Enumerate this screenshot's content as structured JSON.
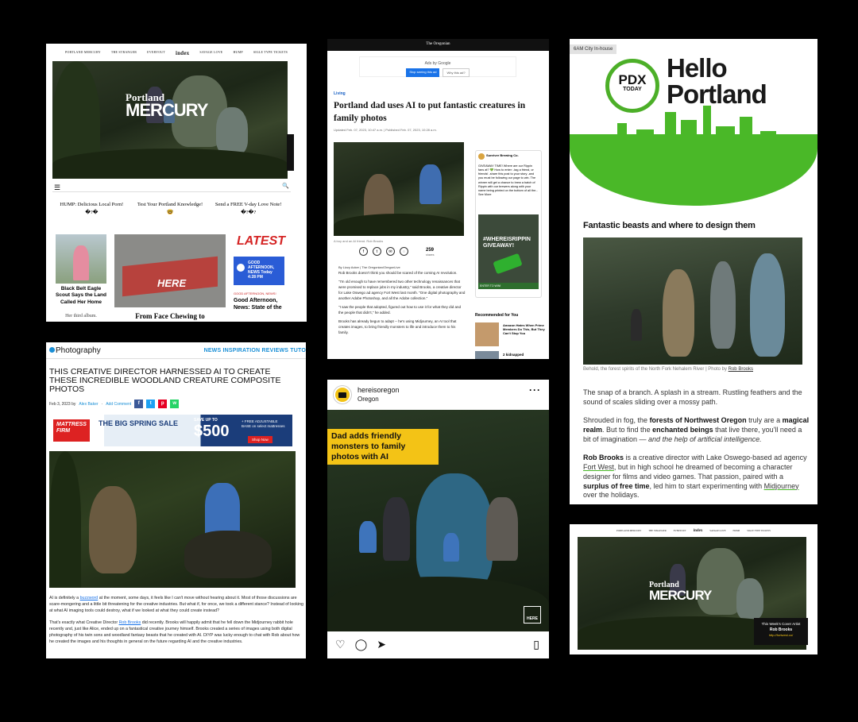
{
  "panel1": {
    "nav": [
      "PORTLAND MERCURY",
      "THE STRANGER",
      "EVERYOUT",
      "index",
      "SAVAGE LOVE",
      "HUMP",
      "SIGLE TYPE TICKETS"
    ],
    "logo_top": "Portland",
    "logo_main": "MERCURY",
    "teasers": [
      "HUMP: Delicious Local Porn! �?�",
      "Test Your Portland Knowledge! 🤓",
      "Send a FREE V-day Love Note! �?�?"
    ],
    "story1_title": "Black Belt Eagle Scout Says the Land Called Her Home",
    "story1_sub": "Her third album.",
    "story2_sign": "HERE",
    "story2_title": "From Face Chewing to",
    "latest": "LATEST",
    "news_card": "GOOD AFTERNOON, NEWS Today 4:28 PM",
    "news_kicker": "GOOD AFTERNOON, NEWS!",
    "news_title": "Good Afternoon, News: State of the"
  },
  "panel2": {
    "topbar": "The Oregonian",
    "ad_label": "Ads by Google",
    "ad_btn1": "Stop seeing this ad",
    "ad_btn2": "Why this ad?",
    "section": "Living",
    "title": "Portland dad uses AI to put fantastic creatures in family photos",
    "meta": "Updated Feb. 07, 2023, 10:47 a.m. | Published Feb. 07, 2023, 10:28 a.m.",
    "caption": "A boy and an AI friend. Rob Brooks",
    "share_count": "259",
    "share_label": "shares",
    "byline": "By Lizzy Acker | The Oregonian/OregonLive",
    "paragraphs": [
      "Rob Brooks doesn't think you should be scared of the coming AI revolution.",
      "\"I'm old enough to have remembered two other technology renaissances that were promised to replace jobs in my industry,\" said Brooks, a creative director for Lake Oswego ad agency Fort West last month. \"One digital photography and another Adobe Photoshop, and all the Adobe collection.\"",
      "\"I saw the people that adopted, figured out how to use it for what they did and the people that didn't,\" he added.",
      "Brooks has already begun to adapt -- he's using Midjourney, an AI tool that creates images, to bring friendly monsters to life and introduce them to his family."
    ],
    "fb_page": "Sunriver Brewing Co.",
    "fb_text": "GIVEAWAY TIME! Where are our Rippin fans at? 💚 How to enter: -tag a friend, or friends! -share this post to your story -and you must be following our page to win. The winner will get a chance to brew a batch of Rippin with our brewers along with your name being printed on the bottom of all the... See More",
    "fb_ad": "#WHEREISRIPPIN GIVEAWAY!",
    "fb_cta": "ENTER TO WIN!",
    "rec_header": "Recommended for You",
    "rec1": "Amazon Hates When Prime Members Do This, But They Can't Stop You",
    "rec2": "2 kidnapped"
  },
  "panel3": {
    "tag": "6AM City In-house",
    "logo_pdx": "PDX",
    "logo_today": "TODAY",
    "hello": "Hello",
    "portland": "Portland",
    "heading": "Fantastic beasts and where to design them",
    "caption": "Behold, the forest spirits of the North Fork Nehalem River | Photo by ",
    "caption_link": "Rob Brooks",
    "p1": "The snap of a branch. A splash in a stream. Rustling feathers and the sound of scales sliding over a mossy path.",
    "p2a": "Shrouded in fog, the ",
    "p2b": "forests of Northwest Oregon",
    "p2c": " truly are a ",
    "p2d": "magical realm",
    "p2e": ". But to find the ",
    "p2f": "enchanted beings",
    "p2g": " that live there, you'll need a bit of imagination — ",
    "p2h": "and the help of artificial intelligence.",
    "p3a": "Rob Brooks",
    "p3b": " is a creative director with Lake Oswego-based ad agency ",
    "p3c": "Fort West",
    "p3d": ", but in high school he dreamed of becoming a character designer for films and video games. That passion, paired with a ",
    "p3e": "surplus of free time",
    "p3f": ", led him to start experimenting with ",
    "p3g": "Midjourney",
    "p3h": " over the holidays."
  },
  "panel4": {
    "logo": "Photography",
    "nav": "NEWS  INSPIRATION  REVIEWS  TUTO",
    "title": "THIS CREATIVE DIRECTOR HARNESSED AI TO CREATE THESE INCREDIBLE WOODLAND CREATURE COMPOSITE PHOTOS",
    "date": "Feb 3, 2023 by",
    "author": "Alex Baker",
    "comment": "Add Comment",
    "ad_brand": "MATTRESS FIRM",
    "ad_sale": "THE BIG SPRING SALE",
    "ad_save": "SAVE UP TO",
    "ad_amount": "$500",
    "ad_free": "+ FREE ADJUSTABLE BASE on select mattresses",
    "ad_shop": "Shop Now",
    "body1a": "AI is definitely a ",
    "body1link": "buzzword",
    "body1b": " at the moment, some days, it feels like I can't move without hearing about it. Most of those discussions are scare-mongering and a little bit threatening for the creative industries. But what if, for once, we took a different stance? Instead of looking at what AI imaging tools could destroy, what if we looked at what they could create instead?",
    "body2a": "That's exactly what Creative Director ",
    "body2link": "Rob Brooks",
    "body2b": " did recently. Brooks will happily admit that he fell down the Midjourney rabbit hole recently and, just like Alice, ended up on a fantastical creative journey himself. Brooks created a series of images using both digital photography of his twin sons and woodland fantasy beasts that he created with AI. DIYP was lucky enough to chat with Rob about how he created the images and his thoughts in general on the future regarding AI and the creative industries."
  },
  "panel5": {
    "username": "hereisoregon",
    "location": "Oregon",
    "headline": "Dad adds friendly monsters to family photos with AI",
    "badge": "HERE"
  },
  "panel6": {
    "nav": [
      "PORTLAND MERCURY",
      "THE STRANGER",
      "EVERYOUT",
      "index",
      "SAVAGE LOVE",
      "HUMP",
      "SIGLE TYPE TICKETS"
    ],
    "logo_top": "Portland",
    "logo_main": "MERCURY",
    "card_title": "This Week's Cover Artist",
    "card_name": "Rob Brooks",
    "card_link": "http://fortwest.co/"
  },
  "colors": {
    "green": "#4ab828",
    "yellow": "#f3c316",
    "blue": "#1a8fd6",
    "red": "#d22"
  }
}
